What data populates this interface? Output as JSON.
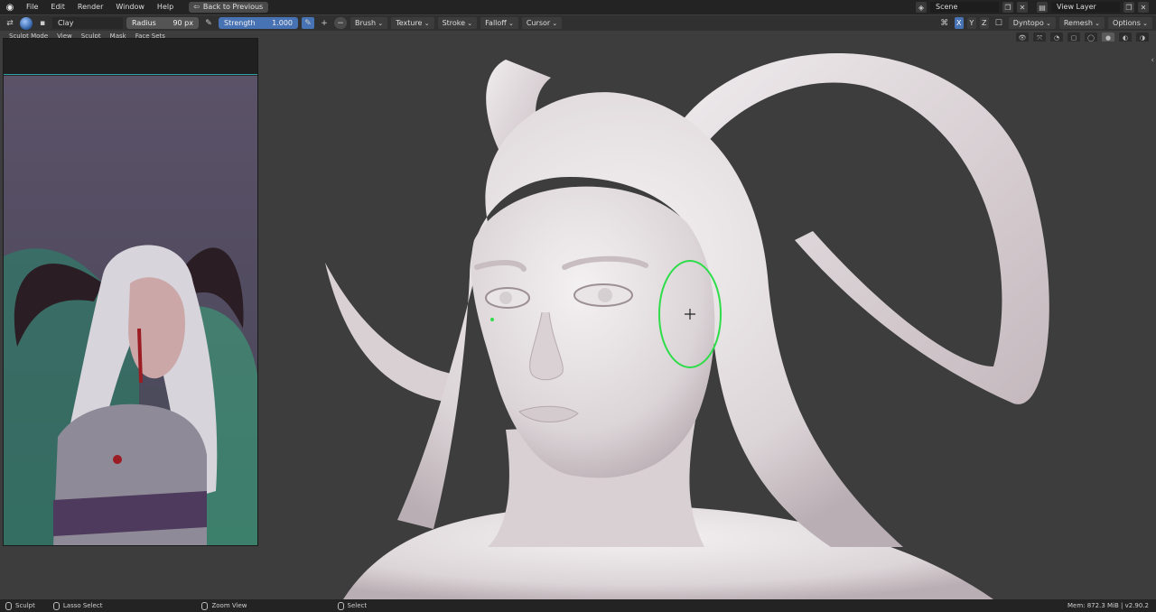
{
  "menu": {
    "items": [
      "File",
      "Edit",
      "Render",
      "Window",
      "Help"
    ],
    "back_button": "Back to Previous"
  },
  "scene": {
    "scene_name": "Scene",
    "view_layer": "View Layer"
  },
  "toolbar": {
    "brush_name": "Clay",
    "radius_label": "Radius",
    "radius_value": "90 px",
    "strength_label": "Strength",
    "strength_value": "1.000",
    "plus": "+",
    "minus": "−",
    "dropdowns": [
      "Brush",
      "Texture",
      "Stroke",
      "Falloff",
      "Cursor"
    ],
    "axes": [
      "X",
      "Y",
      "Z"
    ],
    "dyntopo": "Dyntopo",
    "remesh": "Remesh",
    "options": "Options"
  },
  "modebar": {
    "mode": "Sculpt Mode",
    "items": [
      "View",
      "Sculpt",
      "Mask",
      "Face Sets"
    ]
  },
  "status": {
    "sculpt": "Sculpt",
    "lasso": "Lasso Select",
    "zoom": "Zoom View",
    "select": "Select",
    "memory": "Mem: 872.3 MiB | v2.90.2"
  },
  "colors": {
    "accent_blue": "#4772b3",
    "brush_circle": "#2fdc4a",
    "model": "#e9e4e6"
  }
}
